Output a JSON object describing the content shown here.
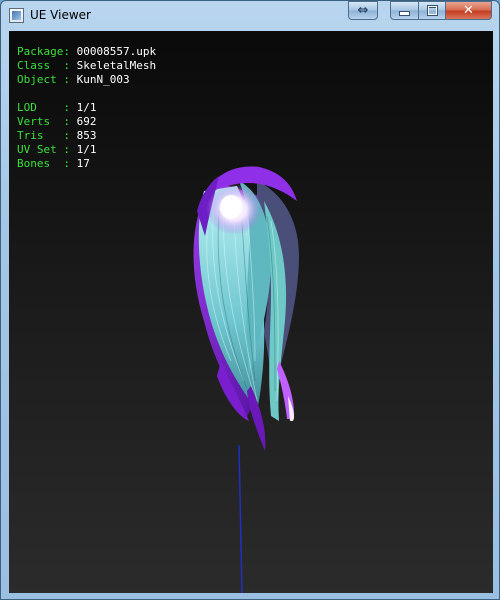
{
  "window": {
    "title": "UE Viewer",
    "icon": "app-icon",
    "buttons": [
      "restore-icon",
      "minimize-icon",
      "maximize-icon",
      "close-icon"
    ],
    "restore_glyph": "⇔",
    "close_glyph": "✕"
  },
  "info": {
    "object_info": [
      {
        "key": "Package:",
        "value": "00008557.upk"
      },
      {
        "key": "Class  :",
        "value": "SkeletalMesh"
      },
      {
        "key": "Object :",
        "value": "KunN_003"
      }
    ],
    "mesh_info": [
      {
        "key": "LOD    :",
        "value": "1/1"
      },
      {
        "key": "Verts  :",
        "value": "692"
      },
      {
        "key": "Tris   :",
        "value": "853"
      },
      {
        "key": "UV Set :",
        "value": "1/1"
      },
      {
        "key": "Bones  :",
        "value": "17"
      }
    ]
  },
  "colors": {
    "label": "#3be03b",
    "value": "#ffffff",
    "hair_cyan": "#7fd3d6",
    "hair_purple": "#8a2be2",
    "axis": "#2030c0"
  }
}
